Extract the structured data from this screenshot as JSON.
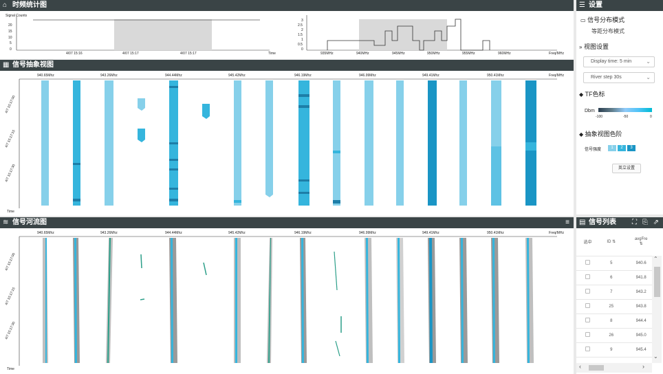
{
  "colors": {
    "header_bg": "#3a4446",
    "light_bar": "#86d0ea",
    "mid_bar": "#35b5dd",
    "dark_bar": "#1a95c5",
    "mark": "#1d7ea8",
    "shade": "#d9d9d9"
  },
  "tf_panel": {
    "title": "时频统计图",
    "icon": "stats-icon",
    "time_chart": {
      "y_label": "Signal Counts",
      "y_ticks": [
        "20",
        "15",
        "10",
        "5",
        "0"
      ],
      "x_ticks": [
        "4/07 15:16",
        "4/07 15:17",
        "4/07 15:17"
      ],
      "x_unit": "Time"
    },
    "freq_chart": {
      "y_ticks": [
        "3",
        "2.5",
        "2",
        "1.5",
        "1",
        "0.5",
        "0"
      ],
      "x_ticks": [
        "935MHz",
        "940MHz",
        "945MHz",
        "950MHz",
        "955MHz",
        "960MHz"
      ],
      "x_unit": "Freq/MHz"
    }
  },
  "abstract_panel": {
    "title": "信号抽象视图",
    "icon": "grid-icon",
    "freq_ticks": [
      "940.65Mhz",
      "943.26Mhz",
      "944.44Mhz",
      "945.42Mhz",
      "946.19Mhz",
      "946.99Mhz",
      "949.41Mhz",
      "950.41Mhz"
    ],
    "freq_unit": "Freq/MHz",
    "time_ticks": [
      "4/7 15:17:00",
      "4/7 15:17:15",
      "4/7 15:17:30"
    ],
    "time_unit": "Time"
  },
  "river_panel": {
    "title": "信号河流图",
    "icon": "river-icon",
    "freq_ticks": [
      "940.65Mhz",
      "943.26Mhz",
      "944.44Mhz",
      "945.42Mhz",
      "946.19Mhz",
      "946.99Mhz",
      "949.41Mhz",
      "950.41Mhz"
    ],
    "freq_unit": "Freq/MHz",
    "time_ticks": [
      "4/7 15:17:00",
      "4/7 15:17:15",
      "4/7 15:17:30"
    ],
    "time_unit": "Time"
  },
  "settings": {
    "title": "设置",
    "dist_mode_label": "信号分布模式",
    "dist_mode_value": "等距分布模式",
    "view_settings_label": "视图设置",
    "display_time": "Display time: 5 min",
    "river_step": "River step 30s",
    "tf_colorbar_label": "TF色标",
    "dbm_label": "Dbm",
    "dbm_ticks": [
      "-100",
      "-50",
      "0"
    ],
    "abstract_color_label": "抽象视图色阶",
    "strength_label": "信号强度",
    "levels": [
      "1",
      "2",
      "3"
    ],
    "confirm_button": "英立设置"
  },
  "signal_list": {
    "title": "信号列表",
    "columns": [
      "选中",
      "ID",
      "avgFre"
    ],
    "rows": [
      {
        "id": "5",
        "avg": "940.6"
      },
      {
        "id": "6",
        "avg": "941.8"
      },
      {
        "id": "7",
        "avg": "943.2"
      },
      {
        "id": "25",
        "avg": "943.8"
      },
      {
        "id": "8",
        "avg": "944.4"
      },
      {
        "id": "26",
        "avg": "945.0"
      },
      {
        "id": "9",
        "avg": "945.4"
      }
    ]
  }
}
